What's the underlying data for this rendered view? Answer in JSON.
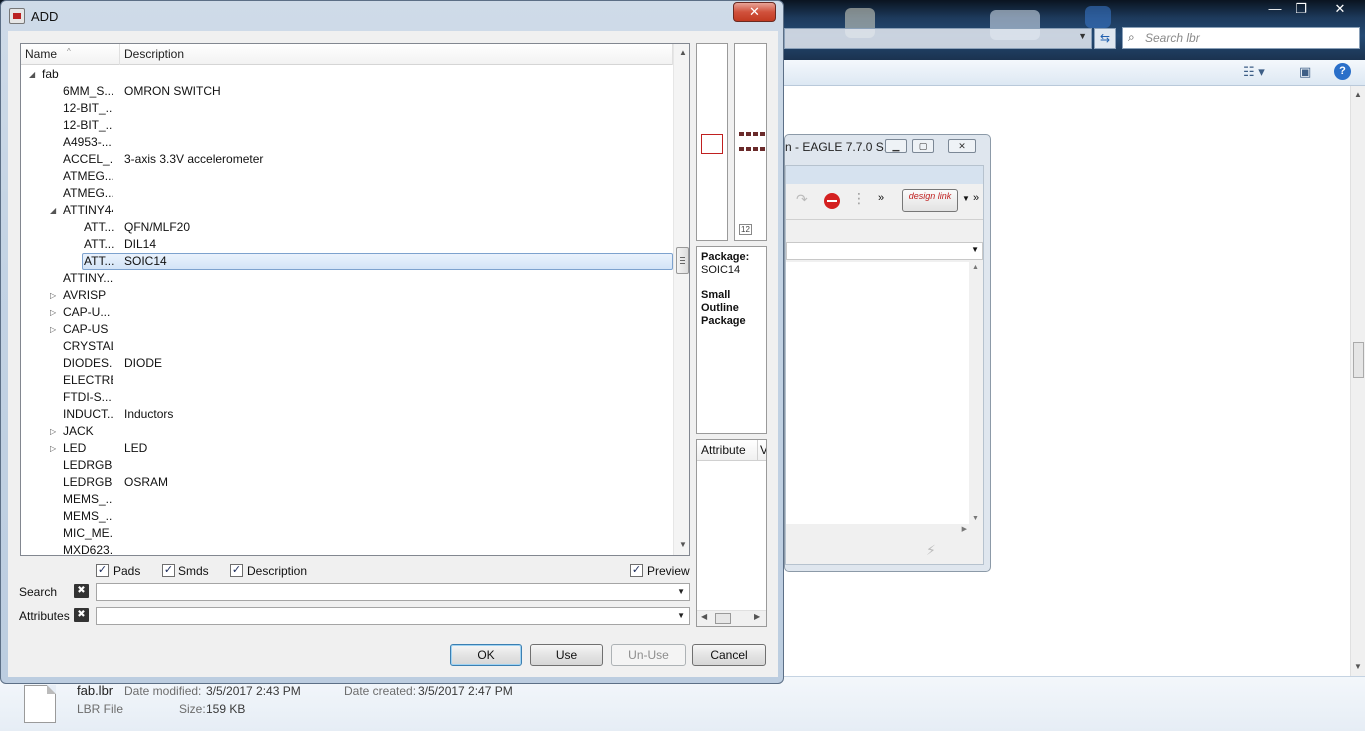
{
  "explorer": {
    "search_placeholder": "Search lbr",
    "window_controls": [
      "—",
      "❐",
      "✕"
    ],
    "details": {
      "file_name": "fab.lbr",
      "file_type": "LBR File",
      "date_modified_label": "Date modified:",
      "date_modified": "3/5/2017 2:43 PM",
      "date_created_label": "Date created:",
      "date_created": "3/5/2017 2:47 PM",
      "size_label": "Size:",
      "size": "159 KB"
    }
  },
  "eagle": {
    "title": "n - EAGLE 7.7.0 S...",
    "design_link": "design link"
  },
  "dialog": {
    "title": "ADD",
    "close": "✕",
    "columns": {
      "name": "Name",
      "description": "Description"
    },
    "rows": [
      {
        "name": "fab",
        "desc": "",
        "level": 0,
        "expander": "open"
      },
      {
        "name": "6MM_S...",
        "desc": "OMRON SWITCH",
        "level": 1,
        "expander": ""
      },
      {
        "name": "12-BIT_...",
        "desc": "",
        "level": 1,
        "expander": ""
      },
      {
        "name": "12-BIT_...",
        "desc": "",
        "level": 1,
        "expander": ""
      },
      {
        "name": "A4953-...",
        "desc": "",
        "level": 1,
        "expander": ""
      },
      {
        "name": "ACCEL_...",
        "desc": "3-axis 3.3V accelerometer",
        "level": 1,
        "expander": ""
      },
      {
        "name": "ATMEG...",
        "desc": "",
        "level": 1,
        "expander": ""
      },
      {
        "name": "ATMEG...",
        "desc": "",
        "level": 1,
        "expander": ""
      },
      {
        "name": "ATTINY44",
        "desc": "",
        "level": 1,
        "expander": "open"
      },
      {
        "name": "ATT...",
        "desc": "QFN/MLF20",
        "level": 2,
        "expander": ""
      },
      {
        "name": "ATT...",
        "desc": "DIL14",
        "level": 2,
        "expander": ""
      },
      {
        "name": "ATT...",
        "desc": "SOIC14",
        "level": 2,
        "expander": "",
        "selected": true
      },
      {
        "name": "ATTINY...",
        "desc": "",
        "level": 1,
        "expander": ""
      },
      {
        "name": "AVRISP",
        "desc": "",
        "level": 1,
        "expander": "closed"
      },
      {
        "name": "CAP-U...",
        "desc": "",
        "level": 1,
        "expander": "closed"
      },
      {
        "name": "CAP-US",
        "desc": "",
        "level": 1,
        "expander": "closed"
      },
      {
        "name": "CRYSTAL",
        "desc": "",
        "level": 1,
        "expander": ""
      },
      {
        "name": "DIODES...",
        "desc": "DIODE",
        "level": 1,
        "expander": ""
      },
      {
        "name": "ELECTRET",
        "desc": "",
        "level": 1,
        "expander": ""
      },
      {
        "name": "FTDI-S...",
        "desc": "",
        "level": 1,
        "expander": ""
      },
      {
        "name": "INDUCT...",
        "desc": "Inductors",
        "level": 1,
        "expander": ""
      },
      {
        "name": "JACK",
        "desc": "",
        "level": 1,
        "expander": "closed"
      },
      {
        "name": "LED",
        "desc": "LED",
        "level": 1,
        "expander": "closed"
      },
      {
        "name": "LEDRGB...",
        "desc": "",
        "level": 1,
        "expander": ""
      },
      {
        "name": "LEDRGB...",
        "desc": "OSRAM",
        "level": 1,
        "expander": ""
      },
      {
        "name": "MEMS_...",
        "desc": "",
        "level": 1,
        "expander": ""
      },
      {
        "name": "MEMS_...",
        "desc": "",
        "level": 1,
        "expander": ""
      },
      {
        "name": "MIC_ME...",
        "desc": "",
        "level": 1,
        "expander": ""
      },
      {
        "name": "MXD623...",
        "desc": "",
        "level": 1,
        "expander": ""
      }
    ],
    "package_label": "Package:",
    "package_name": "SOIC14",
    "package_desc": "Small Outline Package",
    "package_tag": "12",
    "attr_columns": {
      "attribute": "Attribute",
      "value": "V"
    },
    "options": {
      "pads": "Pads",
      "smds": "Smds",
      "description": "Description",
      "preview": "Preview",
      "pads_checked": true,
      "smds_checked": true,
      "description_checked": true,
      "preview_checked": true
    },
    "search_label": "Search",
    "search_value": "",
    "attributes_label": "Attributes",
    "attributes_value": "",
    "clear_glyph": "✖",
    "buttons": {
      "ok": "OK",
      "use": "Use",
      "unuse": "Un-Use",
      "cancel": "Cancel"
    }
  }
}
